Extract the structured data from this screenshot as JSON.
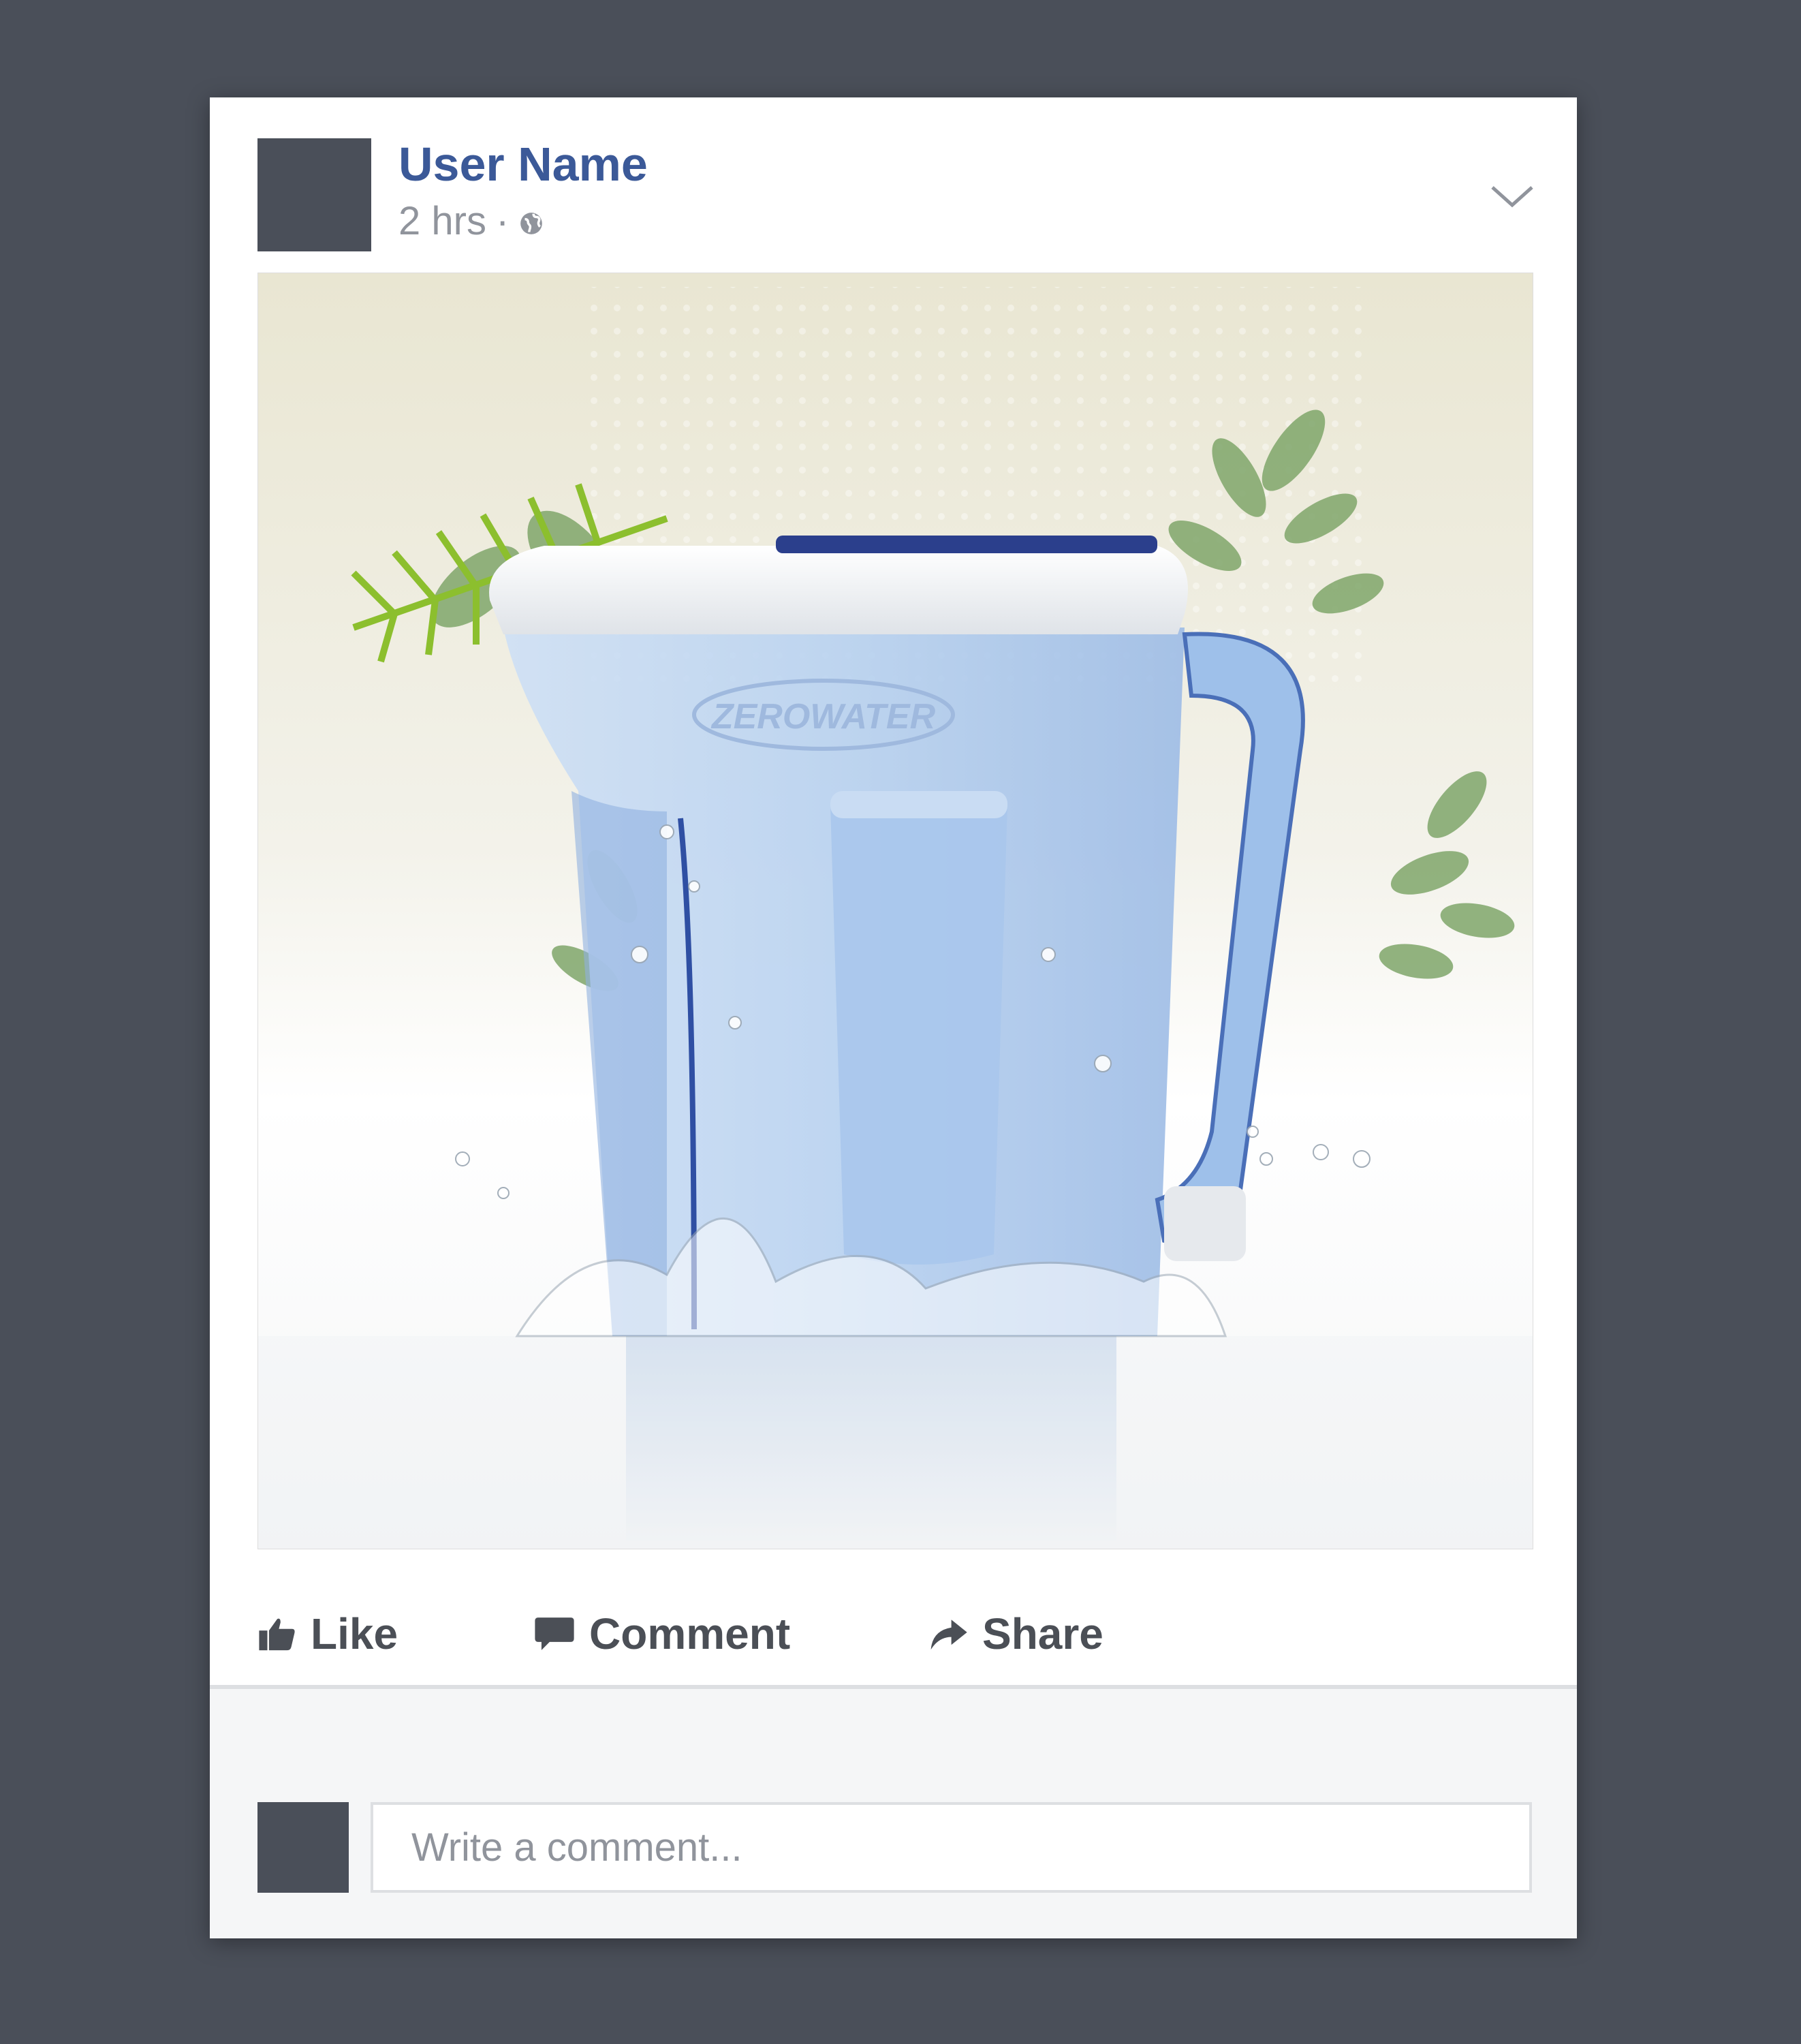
{
  "post": {
    "user_name": "User Name",
    "time": "2 hrs",
    "separator": "·",
    "privacy_icon": "globe-icon",
    "menu_icon": "chevron-down-icon"
  },
  "image": {
    "brand_text": "ZEROWATER",
    "description_icon": "water-pitcher-photo"
  },
  "actions": {
    "like_label": "Like",
    "comment_label": "Comment",
    "share_label": "Share"
  },
  "comment": {
    "placeholder": "Write a comment..."
  },
  "colors": {
    "background": "#4a4f59",
    "user_name": "#3b5998",
    "meta_text": "#90949c",
    "action_text": "#4b4f56",
    "comment_bg": "#f5f6f7"
  }
}
